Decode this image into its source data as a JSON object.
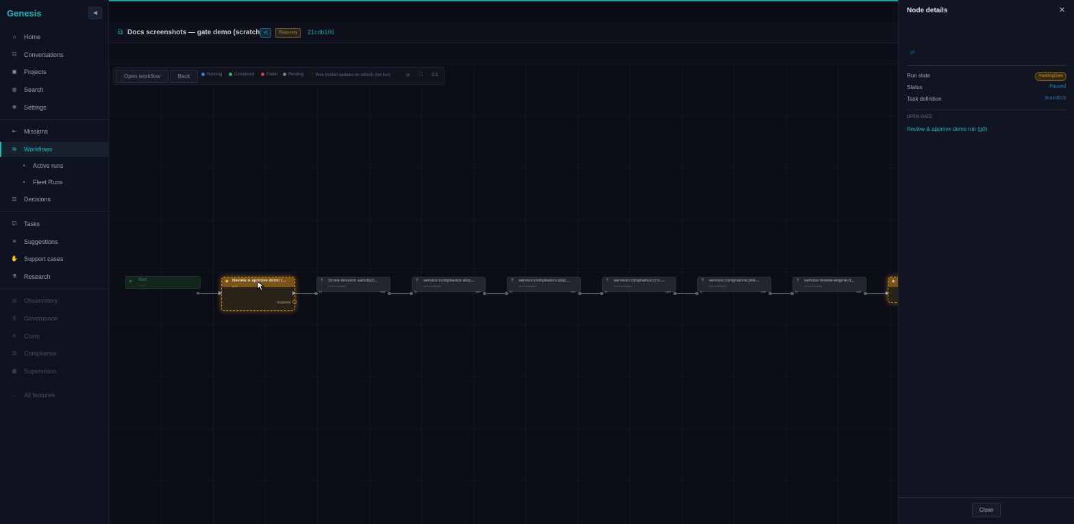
{
  "app": {
    "name": "Genesis",
    "accent": "#1fb7bc"
  },
  "sidebar": {
    "collapse_icon": "chevron-left-icon",
    "primary": [
      {
        "label": "Home",
        "icon": "home-icon"
      },
      {
        "label": "Conversations",
        "icon": "list-icon"
      },
      {
        "label": "Projects",
        "icon": "folder-icon"
      },
      {
        "label": "Search",
        "icon": "search-icon"
      },
      {
        "label": "Settings",
        "icon": "gear-icon"
      }
    ],
    "work": [
      {
        "label": "Missions",
        "icon": "arrow-icon"
      },
      {
        "label": "Workflows",
        "icon": "workflow-icon",
        "active": true
      },
      {
        "label": "Active runs",
        "icon": "dot-icon"
      },
      {
        "label": "Fleet Runs",
        "icon": "dot-icon"
      },
      {
        "label": "Decisions",
        "icon": "decision-icon"
      }
    ],
    "secondary": [
      {
        "label": "Tasks",
        "icon": "check-icon"
      },
      {
        "label": "Suggestions",
        "icon": "sparkle-icon"
      },
      {
        "label": "Support cases",
        "icon": "hand-icon"
      },
      {
        "label": "Research",
        "icon": "flask-icon"
      }
    ],
    "tertiary": [
      {
        "label": "Observatory",
        "icon": "eye-icon"
      },
      {
        "label": "Governance",
        "icon": "section-icon"
      },
      {
        "label": "Costs",
        "icon": "coin-icon"
      },
      {
        "label": "Compliance",
        "icon": "scale-icon"
      },
      {
        "label": "Supervision",
        "icon": "grid-icon"
      }
    ],
    "all_features": "All features",
    "all_features_icon": "ellipsis-icon"
  },
  "header": {
    "title": "Docs screenshots — gate demo (scratch)",
    "version_badge": "v1",
    "readonly_badge": "Read-only",
    "hash": "21cdb106"
  },
  "toolbar": {
    "open_workflow": "Open workflow",
    "back": "Back",
    "legend": [
      {
        "label": "Running",
        "color": "#3a7fd8"
      },
      {
        "label": "Completed",
        "color": "#3bb35a"
      },
      {
        "label": "Failed",
        "color": "#d04040"
      },
      {
        "label": "Pending",
        "color": "#7a7e8a"
      }
    ],
    "live_note": "Wire frontier updates on refresh (not live)",
    "zoom_label": "1:1"
  },
  "graph": {
    "start": {
      "title": "Start",
      "sub": "event"
    },
    "gate": {
      "title": "Review & approve demo r...",
      "sub": "gate",
      "port_in": "in",
      "port_out": "out",
      "response": "response"
    },
    "nodes": [
      {
        "title": "Score mission satisfact...",
        "sub": "serviceAdapter",
        "in": "in",
        "out": "out"
      },
      {
        "title": "service:compliance:atac...",
        "sub": "serviceAdapter",
        "in": "in",
        "out": "out"
      },
      {
        "title": "service:compliance:atac...",
        "sub": "serviceAdapter",
        "in": "in",
        "out": "out"
      },
      {
        "title": "service:compliance:crs-...",
        "sub": "serviceAdapter",
        "in": "in",
        "out": "out"
      },
      {
        "title": "service:compliance:pfd-...",
        "sub": "serviceAdapter",
        "in": "in",
        "out": "out"
      },
      {
        "title": "service:review-engine:d...",
        "sub": "serviceAdapter",
        "in": "in",
        "out": "out"
      }
    ]
  },
  "panel": {
    "title": "Node details",
    "node_id": "g0",
    "rows": [
      {
        "label": "Run state",
        "value": "AwaitingGate",
        "kind": "pill"
      },
      {
        "label": "Status",
        "value": "Paused",
        "kind": "text"
      },
      {
        "label": "Task definition",
        "value": "9ca1d019",
        "kind": "text"
      }
    ],
    "section_label": "OPEN GATE",
    "gate_link": "Review & approve demo run (g0)",
    "close": "Close"
  }
}
